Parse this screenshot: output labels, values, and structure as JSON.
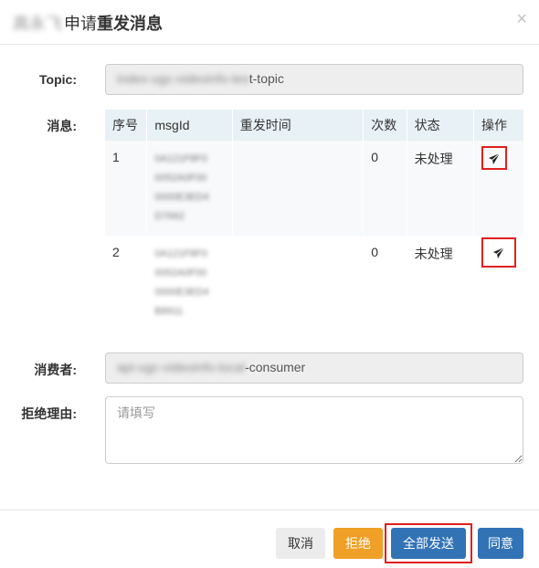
{
  "header": {
    "title_blurred": "高永飞",
    "title_prefix": "申请",
    "title_bold": "重发消息",
    "close_glyph": "×"
  },
  "form": {
    "topic_label": "Topic:",
    "topic_value_blurred": "index-ugc-videoinfo-tes",
    "topic_value_visible": "t-topic",
    "messages_label": "消息:",
    "consumer_label": "消费者:",
    "consumer_value_blurred": "api-ugc-videoinfo-local",
    "consumer_value_visible": "-consumer",
    "reason_label": "拒绝理由:",
    "reason_placeholder": "请填写"
  },
  "table": {
    "headers": [
      "序号",
      "msgId",
      "重发时间",
      "次数",
      "状态",
      "操作"
    ],
    "rows": [
      {
        "index": "1",
        "msgid": "0A121F8F0 0052A0F00 0000E3ED4 D7662",
        "resend_time": "",
        "count": "0",
        "status": "未处理"
      },
      {
        "index": "2",
        "msgid": "0A121F8F0 0052A0F00 0000E3ED4 B8911",
        "resend_time": "",
        "count": "0",
        "status": "未处理"
      }
    ]
  },
  "footer": {
    "cancel": "取消",
    "reject": "拒绝",
    "send_all": "全部发送",
    "agree": "同意"
  },
  "colors": {
    "primary": "#3273b6",
    "warning": "#f0a026",
    "highlight_border": "#e0201e",
    "table_header": "#e8f1f6"
  }
}
